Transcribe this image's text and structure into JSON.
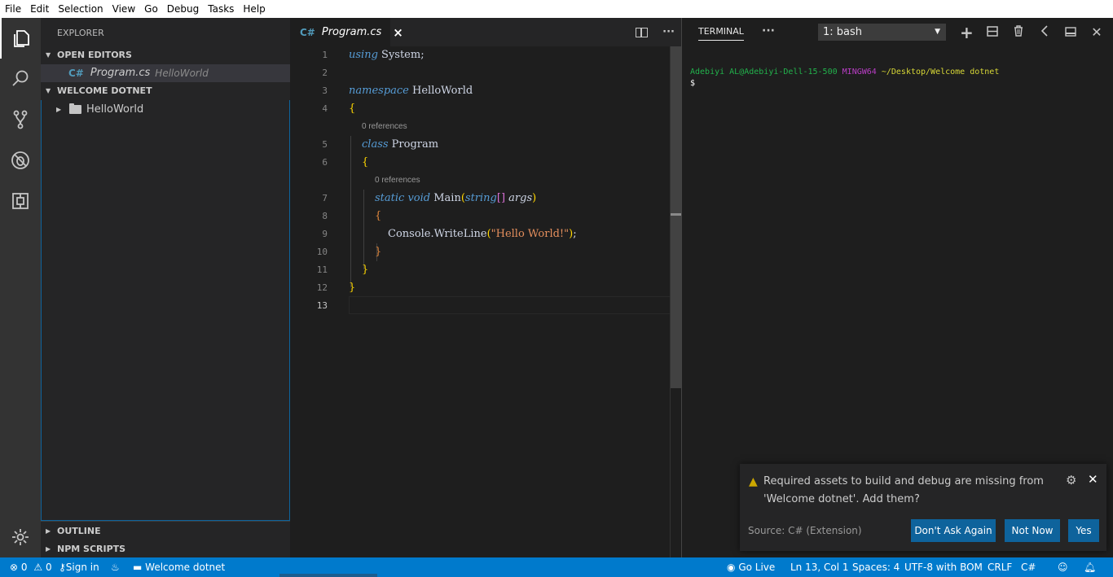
{
  "menubar": [
    "File",
    "Edit",
    "Selection",
    "View",
    "Go",
    "Debug",
    "Tasks",
    "Help"
  ],
  "activity_icons": [
    "explorer-icon",
    "search-icon",
    "source-control-icon",
    "debug-icon",
    "extensions-icon",
    "settings-gear-icon"
  ],
  "sidebar": {
    "title": "EXPLORER",
    "open_editors": {
      "label": "OPEN EDITORS",
      "file": {
        "lang": "C#",
        "name": "Program.cs",
        "folder": "HelloWorld"
      }
    },
    "workspace": {
      "label": "WELCOME DOTNET",
      "folder": "HelloWorld"
    },
    "outline": "OUTLINE",
    "npm": "NPM SCRIPTS"
  },
  "editor": {
    "tab": {
      "lang": "C#",
      "name": "Program.cs",
      "close": "×"
    },
    "actions_more": "···",
    "line_numbers": [
      "1",
      "2",
      "3",
      "4",
      "5",
      "6",
      "7",
      "8",
      "9",
      "10",
      "11",
      "12",
      "13"
    ],
    "references": "0 references",
    "code": {
      "l1_kw": "using",
      "l1_rest": " System;",
      "l3_kw": "namespace",
      "l3_rest": " HelloWorld",
      "l4": "{",
      "l5_kw": "class",
      "l5_rest": " Program",
      "l6": "{",
      "l7_kw": "static void",
      "l7_name": " Main",
      "l7_open": "(",
      "l7_type": "string",
      "l7_arr": "[]",
      "l7_arg": " args",
      "l7_close": ")",
      "l8": "{",
      "l9_call": "Console.WriteLine",
      "l9_open": "(",
      "l9_str": "\"Hello World!\"",
      "l9_close": ")",
      "l9_end": ";",
      "l10": "}",
      "l11": "}",
      "l12": "}"
    }
  },
  "terminal": {
    "tab_label": "TERMINAL",
    "more": "···",
    "selected_shell": "1: bash",
    "prompt_user": "Adebiyi AL@Adebiyi-Dell-15-500",
    "prompt_env": "MINGW64",
    "prompt_path": "~/Desktop/Welcome dotnet",
    "prompt_symbol": "$"
  },
  "notification": {
    "message": "Required assets to build and debug are missing from 'Welcome dotnet'. Add them?",
    "source": "Source: C# (Extension)",
    "buttons": [
      "Don't Ask Again",
      "Not Now",
      "Yes"
    ]
  },
  "statusbar": {
    "errors": "0",
    "warnings": "0",
    "sign_in": "Sign in",
    "folder": "Welcome dotnet",
    "go_live": "Go Live",
    "position": "Ln 13, Col 1",
    "spaces": "Spaces: 4",
    "encoding": "UTF-8 with BOM",
    "eol": "CRLF",
    "language": "C#"
  },
  "colors": {
    "accent": "#007acc",
    "button": "#0e639c",
    "keyword": "#569cd6",
    "string": "#e58f5d"
  }
}
